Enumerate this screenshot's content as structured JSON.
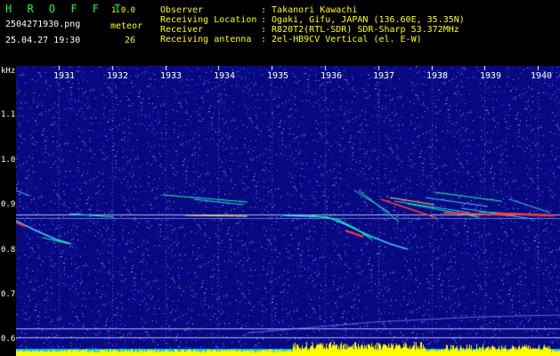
{
  "app": {
    "logo": "H R O F F T",
    "version": "1.0.0"
  },
  "file": {
    "filename": "2504271930.png",
    "datetime": "25.04.27 19:30"
  },
  "meteor": {
    "label": "meteor",
    "count": "26"
  },
  "station": {
    "labels": [
      "Observer",
      "Receiving Location",
      "Receiver",
      "Receiving antenna"
    ],
    "values": [
      ": Takanori Kawachi",
      ": Ogaki, Gifu, JAPAN (136.60E, 35.35N)",
      ": R820T2(RTL-SDR) SDR-Sharp 53.372MHz",
      ": 2el-HB9CV Vertical (el. E-W)"
    ]
  },
  "axes": {
    "yunit": "kHz",
    "yticks": [
      "1.1",
      "1.0",
      "0.9",
      "0.8",
      "0.7",
      "0.6"
    ],
    "xticks": [
      "1931",
      "1932",
      "1933",
      "1934",
      "1935",
      "1936",
      "1937",
      "1938",
      "1939",
      "1940"
    ],
    "ylim": [
      0.58,
      1.18
    ]
  },
  "colors": {
    "background": "#0a0a7c",
    "trail": "#00ff9a",
    "signal": "#ff3b3b",
    "level": "#ffff00",
    "level_base": "#00c8ff"
  }
}
